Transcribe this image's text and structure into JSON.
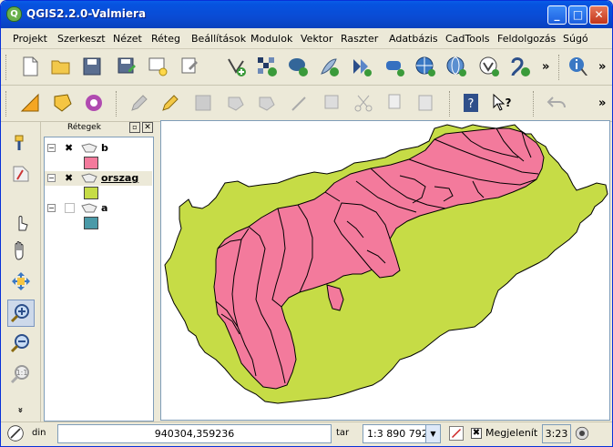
{
  "window": {
    "title": "QGIS2.2.0-Valmiera",
    "icon_letter": "Q",
    "min": "_",
    "max": "□",
    "close": "✕"
  },
  "menu": [
    "Projekt",
    "Szerkeszt",
    "Nézet",
    "Réteg",
    "Beállítások",
    "Modulok",
    "Vektor",
    "Raszter",
    "Adatbázis",
    "CadTools",
    "Feldolgozás",
    "Súgó"
  ],
  "toolbar1": {
    "more": "»",
    "more2": "»"
  },
  "toolbar2": {
    "more": "»"
  },
  "layers_panel": {
    "title": "Rétegek",
    "layers": [
      {
        "name": "b",
        "visible": true,
        "fill": "#f37a9c"
      },
      {
        "name": "orszag",
        "visible": true,
        "fill": "#c6dc46"
      },
      {
        "name": "a",
        "visible": false,
        "fill": "#4a9aa8"
      }
    ]
  },
  "status": {
    "coord_label": "din",
    "coordinate": "940304,359236",
    "scale_label": "tar",
    "scale": "1:3 890 792",
    "render_label": "Megjelenít",
    "time": "3:23",
    "more": "»"
  },
  "colors": {
    "accent": "#0a4bd4",
    "land": "#c6dc46",
    "zone": "#f37a9c"
  }
}
